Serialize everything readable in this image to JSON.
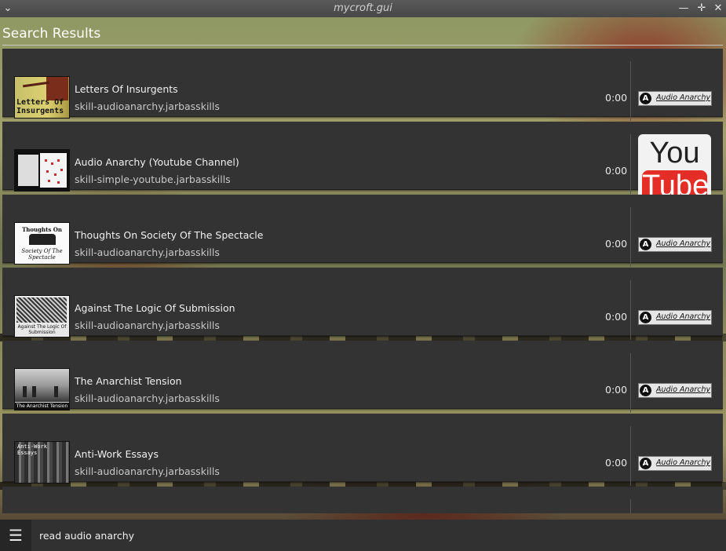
{
  "window": {
    "title": "mycroft.gui",
    "menu_icon": "chevron-down-icon",
    "minimize_icon": "minimize-icon",
    "maximize_icon": "maximize-icon",
    "close_icon": "close-icon"
  },
  "header": {
    "title": "Search Results"
  },
  "results": [
    {
      "title": "Letters Of Insurgents",
      "skill": "skill-audioanarchy.jarbasskills",
      "duration": "0:00",
      "source_logo": "Audio Anarchy",
      "thumb_text": "Letters Of Insurgents"
    },
    {
      "title": "Audio Anarchy (Youtube Channel)",
      "skill": "skill-simple-youtube.jarbasskills",
      "duration": "0:00",
      "source_logo": "YouTube",
      "logo_top": "You",
      "logo_bottom": "Tube"
    },
    {
      "title": "Thoughts On Society Of The Spectacle",
      "skill": "skill-audioanarchy.jarbasskills",
      "duration": "0:00",
      "source_logo": "Audio Anarchy",
      "thumb_text_top": "Thoughts On",
      "thumb_text_bottom": "Society Of The Spectacle"
    },
    {
      "title": "Against The Logic Of Submission",
      "skill": "skill-audioanarchy.jarbasskills",
      "duration": "0:00",
      "source_logo": "Audio Anarchy",
      "thumb_text": "Against The Logic Of Submission"
    },
    {
      "title": "The Anarchist Tension",
      "skill": "skill-audioanarchy.jarbasskills",
      "duration": "0:00",
      "source_logo": "Audio Anarchy",
      "thumb_text": "The Anarchist Tension"
    },
    {
      "title": "Anti-Work Essays",
      "skill": "skill-audioanarchy.jarbasskills",
      "duration": "0:00",
      "source_logo": "Audio Anarchy",
      "thumb_text": "Anti-Work Essays"
    }
  ],
  "bottombar": {
    "menu_icon": "hamburger-menu-icon",
    "query_value": "read audio anarchy"
  }
}
